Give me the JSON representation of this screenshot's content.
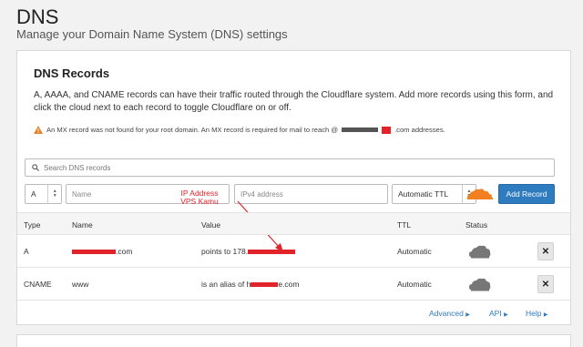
{
  "page": {
    "title": "DNS",
    "subtitle": "Manage your Domain Name System (DNS) settings"
  },
  "card": {
    "title": "DNS Records",
    "description": "A, AAAA, and CNAME records can have their traffic routed through the Cloudflare system. Add more records using this form, and click the cloud next to each record to toggle Cloudflare on or off.",
    "warning_prefix": "An MX record was not found for your root domain. An MX record is required for mail to reach @",
    "warning_suffix": ".com addresses."
  },
  "search": {
    "placeholder": "Search DNS records"
  },
  "form": {
    "type_value": "A",
    "name_placeholder": "Name",
    "ipv4_placeholder": "IPv4 address",
    "ttl_value": "Automatic TTL",
    "add_button": "Add Record"
  },
  "annotation": {
    "text": "IP Address VPS Kamu"
  },
  "table": {
    "headers": {
      "type": "Type",
      "name": "Name",
      "value": "Value",
      "ttl": "TTL",
      "status": "Status"
    },
    "rows": [
      {
        "type": "A",
        "name_suffix": ".com",
        "value_prefix": "points to 178.",
        "ttl": "Automatic"
      },
      {
        "type": "CNAME",
        "name": "www",
        "value_prefix": "is an alias of h",
        "value_suffix": "e.com",
        "ttl": "Automatic"
      }
    ]
  },
  "footer": {
    "advanced": "Advanced",
    "api": "API",
    "help": "Help"
  },
  "colors": {
    "accent": "#2f7bbf",
    "annotation_red": "#e2232a",
    "cloud_orange": "#f38020"
  },
  "icons": [
    "search-icon",
    "warning-icon",
    "orange-cloud-icon",
    "grey-cloud-icon",
    "close-icon",
    "chevron-right-icon"
  ]
}
